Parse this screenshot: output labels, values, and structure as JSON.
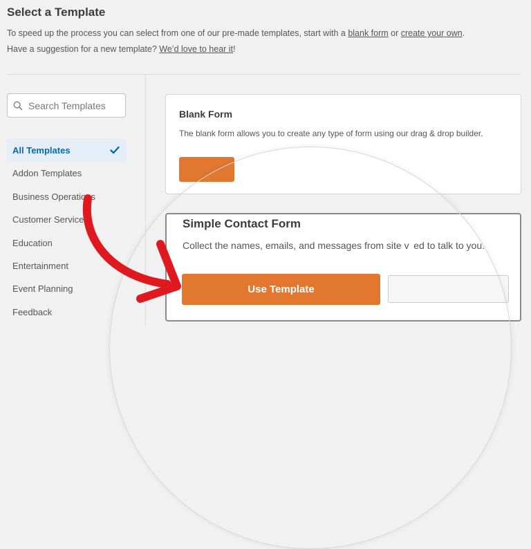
{
  "header": {
    "title": "Select a Template",
    "desc_part1": "To speed up the process you can select from one of our pre-made templates, start with a ",
    "blank_form_link": "blank form",
    "desc_or": " or ",
    "create_own_link": "create your own",
    "desc_period": ".",
    "desc_part2": "Have a suggestion for a new template? ",
    "love_link": "We’d love to hear it",
    "desc_end": "!"
  },
  "search": {
    "placeholder": "Search Templates",
    "icon": "search-icon"
  },
  "categories": [
    "All Templates",
    "Addon Templates",
    "Business Operations",
    "Customer Service",
    "Education",
    "Entertainment",
    "Event Planning",
    "Feedback"
  ],
  "active_category": "All Templates",
  "templates": [
    {
      "title": "Blank Form",
      "description": "The blank form allows you to create any type of form using our drag & drop builder."
    },
    {
      "title": "Simple Contact Form",
      "description": "Collect the names, emails, and messages from site v  ed to talk to you.",
      "button": "Use Template"
    }
  ],
  "colors": {
    "accent": "#e27730",
    "active_bg": "#e5eef8",
    "active_text": "#036aab",
    "arrow": "#e0191f"
  }
}
